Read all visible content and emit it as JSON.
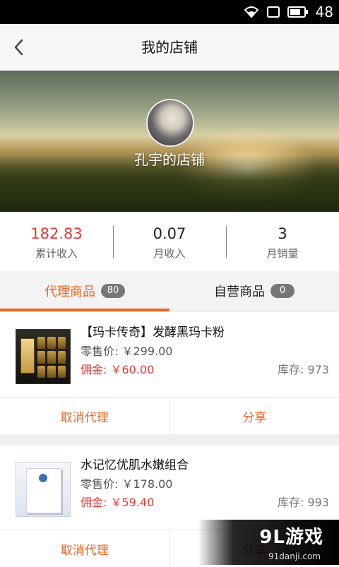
{
  "status_bar": {
    "time": "48"
  },
  "header": {
    "title": "我的店铺"
  },
  "shop": {
    "name": "孔宇的店铺"
  },
  "stats": [
    {
      "value": "182.83",
      "label": "累计收入"
    },
    {
      "value": "0.07",
      "label": "月收入"
    },
    {
      "value": "3",
      "label": "月销量"
    }
  ],
  "tabs": [
    {
      "label": "代理商品",
      "count": "80",
      "active": true
    },
    {
      "label": "自营商品",
      "count": "0",
      "active": false
    }
  ],
  "products": [
    {
      "name": "【玛卡传奇】发酵黑玛卡粉",
      "retail": "零售价: ￥299.00",
      "commission": "佣金: ￥60.00",
      "stock": "库存: 973",
      "action_left": "取消代理",
      "action_right": "分享"
    },
    {
      "name": "水记忆优肌水嫩组合",
      "retail": "零售价: ￥178.00",
      "commission": "佣金: ￥59.40",
      "stock": "库存: 993",
      "action_left": "取消代理",
      "action_right": "分享"
    }
  ],
  "watermark": {
    "logo": "9L游戏",
    "url": "91danji.com"
  },
  "colors": {
    "accent": "#f26522",
    "red": "#e53935"
  }
}
